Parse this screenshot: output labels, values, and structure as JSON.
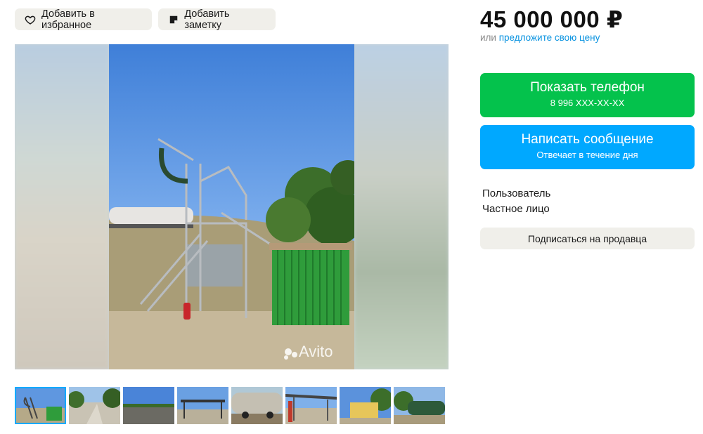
{
  "actions": {
    "favorite_label": "Добавить в избранное",
    "note_label": "Добавить заметку"
  },
  "price": {
    "amount": "45 000 000 ₽",
    "offer_prefix": "или",
    "offer_link": "предложите свою цену"
  },
  "contact": {
    "phone_label": "Показать телефон",
    "phone_masked": "8 996 XXX-XX-XX",
    "message_label": "Написать сообщение",
    "message_sub": "Отвечает в течение дня",
    "phone_color": "#04c24c",
    "message_color": "#00a8ff"
  },
  "seller": {
    "role": "Пользователь",
    "type": "Частное лицо",
    "subscribe_label": "Подписаться на продавца"
  },
  "gallery": {
    "watermark": "Avito",
    "thumbnail_count": 8,
    "active_index": 0
  }
}
